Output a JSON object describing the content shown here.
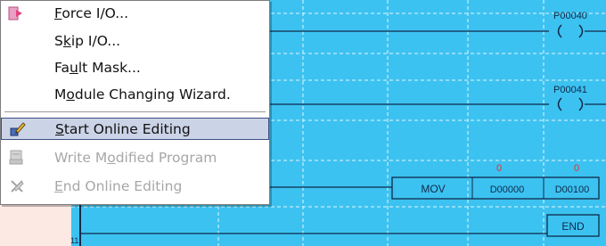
{
  "menu": {
    "items": [
      {
        "pre": "",
        "key": "F",
        "post": "orce I/O...",
        "state": "normal"
      },
      {
        "pre": "S",
        "key": "k",
        "post": "ip I/O...",
        "state": "normal"
      },
      {
        "pre": "Fa",
        "key": "u",
        "post": "lt Mask...",
        "state": "normal"
      },
      {
        "pre": "M",
        "key": "o",
        "post": "dule Changing Wizard.",
        "state": "normal"
      },
      {
        "pre": "",
        "key": "S",
        "post": "tart Online Editing",
        "state": "selected"
      },
      {
        "pre": "Write M",
        "key": "o",
        "post": "dified Program",
        "state": "disabled"
      },
      {
        "pre": "",
        "key": "E",
        "post": "nd Online Editing",
        "state": "disabled"
      }
    ]
  },
  "ladder": {
    "coil_1": "P00040",
    "coil_2": "P00041",
    "instruction": "MOV",
    "operand_1": "D00000",
    "operand_2": "D00100",
    "value_1": "0",
    "value_2": "0",
    "end_label": "END",
    "row_number": "11"
  },
  "colors": {
    "background": "#3cc2f1",
    "rung": "#0f2a4a",
    "value": "#e8322a"
  }
}
